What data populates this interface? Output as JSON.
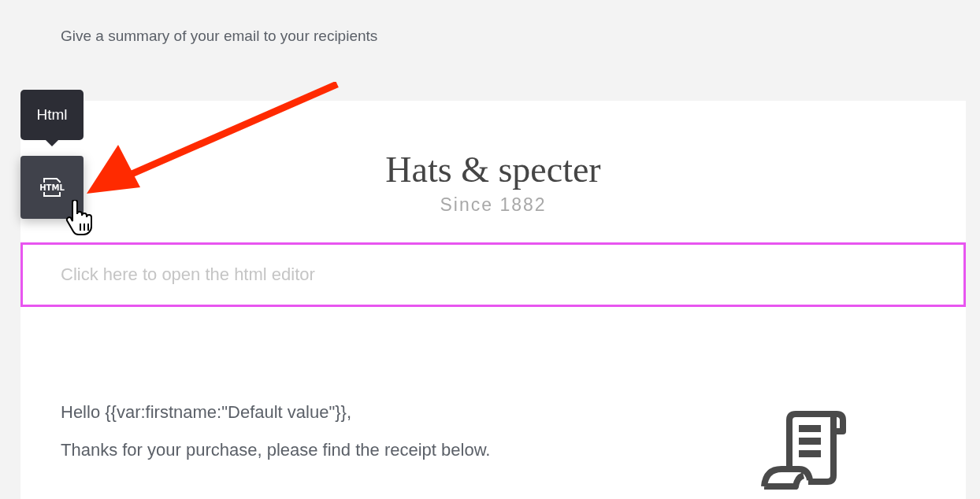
{
  "summary": "Give a summary of your email to your recipients",
  "tooltip": {
    "label": "Html"
  },
  "html_button": {
    "icon_label": "HTML",
    "hovered": true
  },
  "logo": {
    "name": "Hats & specter",
    "tagline": "Since 1882"
  },
  "html_block": {
    "placeholder": "Click here to open the html editor",
    "selected": true
  },
  "body_lines": [
    "Hello {{var:firstname:\"Default value\"}},",
    "Thanks for your purchase, please find the receipt below."
  ],
  "annotation": {
    "kind": "arrow",
    "color": "#ff2a00"
  }
}
